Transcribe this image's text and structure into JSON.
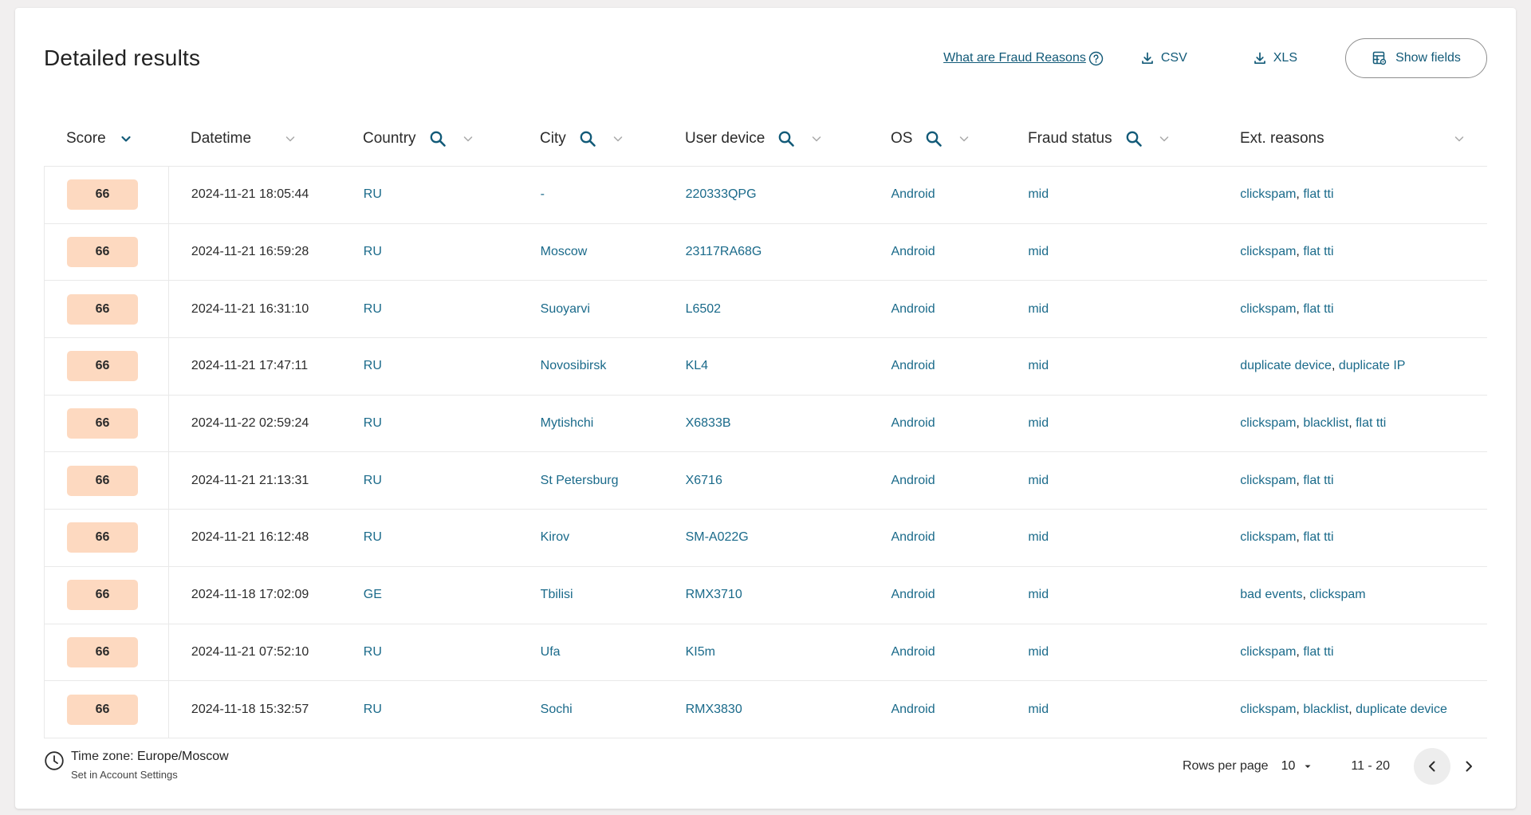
{
  "header": {
    "title": "Detailed results",
    "fraud_reasons_link": "What are Fraud Reasons",
    "csv_label": "CSV",
    "xls_label": "XLS",
    "show_fields_label": "Show fields"
  },
  "columns": {
    "score": "Score",
    "datetime": "Datetime",
    "country": "Country",
    "city": "City",
    "user_device": "User device",
    "os": "OS",
    "fraud_status": "Fraud status",
    "ext_reasons": "Ext. reasons"
  },
  "rows": [
    {
      "score": "66",
      "datetime": "2024-11-21 18:05:44",
      "country": "RU",
      "city": "-",
      "device": "220333QPG",
      "os": "Android",
      "fraud": "mid",
      "ext": [
        "clickspam",
        "flat tti"
      ]
    },
    {
      "score": "66",
      "datetime": "2024-11-21 16:59:28",
      "country": "RU",
      "city": "Moscow",
      "device": "23117RA68G",
      "os": "Android",
      "fraud": "mid",
      "ext": [
        "clickspam",
        "flat tti"
      ]
    },
    {
      "score": "66",
      "datetime": "2024-11-21 16:31:10",
      "country": "RU",
      "city": "Suoyarvi",
      "device": "L6502",
      "os": "Android",
      "fraud": "mid",
      "ext": [
        "clickspam",
        "flat tti"
      ]
    },
    {
      "score": "66",
      "datetime": "2024-11-21 17:47:11",
      "country": "RU",
      "city": "Novosibirsk",
      "device": "KL4",
      "os": "Android",
      "fraud": "mid",
      "ext": [
        "duplicate device",
        "duplicate IP"
      ]
    },
    {
      "score": "66",
      "datetime": "2024-11-22 02:59:24",
      "country": "RU",
      "city": "Mytishchi",
      "device": "X6833B",
      "os": "Android",
      "fraud": "mid",
      "ext": [
        "clickspam",
        "blacklist",
        "flat tti"
      ]
    },
    {
      "score": "66",
      "datetime": "2024-11-21 21:13:31",
      "country": "RU",
      "city": "St Petersburg",
      "device": "X6716",
      "os": "Android",
      "fraud": "mid",
      "ext": [
        "clickspam",
        "flat tti"
      ]
    },
    {
      "score": "66",
      "datetime": "2024-11-21 16:12:48",
      "country": "RU",
      "city": "Kirov",
      "device": "SM-A022G",
      "os": "Android",
      "fraud": "mid",
      "ext": [
        "clickspam",
        "flat tti"
      ]
    },
    {
      "score": "66",
      "datetime": "2024-11-18 17:02:09",
      "country": "GE",
      "city": "Tbilisi",
      "device": "RMX3710",
      "os": "Android",
      "fraud": "mid",
      "ext": [
        "bad events",
        "clickspam"
      ]
    },
    {
      "score": "66",
      "datetime": "2024-11-21 07:52:10",
      "country": "RU",
      "city": "Ufa",
      "device": "KI5m",
      "os": "Android",
      "fraud": "mid",
      "ext": [
        "clickspam",
        "flat tti"
      ]
    },
    {
      "score": "66",
      "datetime": "2024-11-18 15:32:57",
      "country": "RU",
      "city": "Sochi",
      "device": "RMX3830",
      "os": "Android",
      "fraud": "mid",
      "ext": [
        "clickspam",
        "blacklist",
        "duplicate device"
      ]
    }
  ],
  "footer": {
    "timezone_label": "Time zone: ",
    "timezone_value": "Europe/Moscow",
    "timezone_note": "Set in Account Settings",
    "rows_per_page_label": "Rows per page",
    "rows_per_page_value": "10",
    "range": "11 - 20"
  },
  "colors": {
    "link": "#1a6a8a",
    "accent": "#125a78",
    "score_badge": "#fdd9c0"
  },
  "icons": {
    "help": "question-circle-icon",
    "download": "download-icon",
    "show_fields": "table-settings-icon",
    "search": "search-icon",
    "sort": "chevron-down-icon",
    "clock": "clock-icon",
    "prev": "chevron-left-icon",
    "next": "chevron-right-icon"
  }
}
